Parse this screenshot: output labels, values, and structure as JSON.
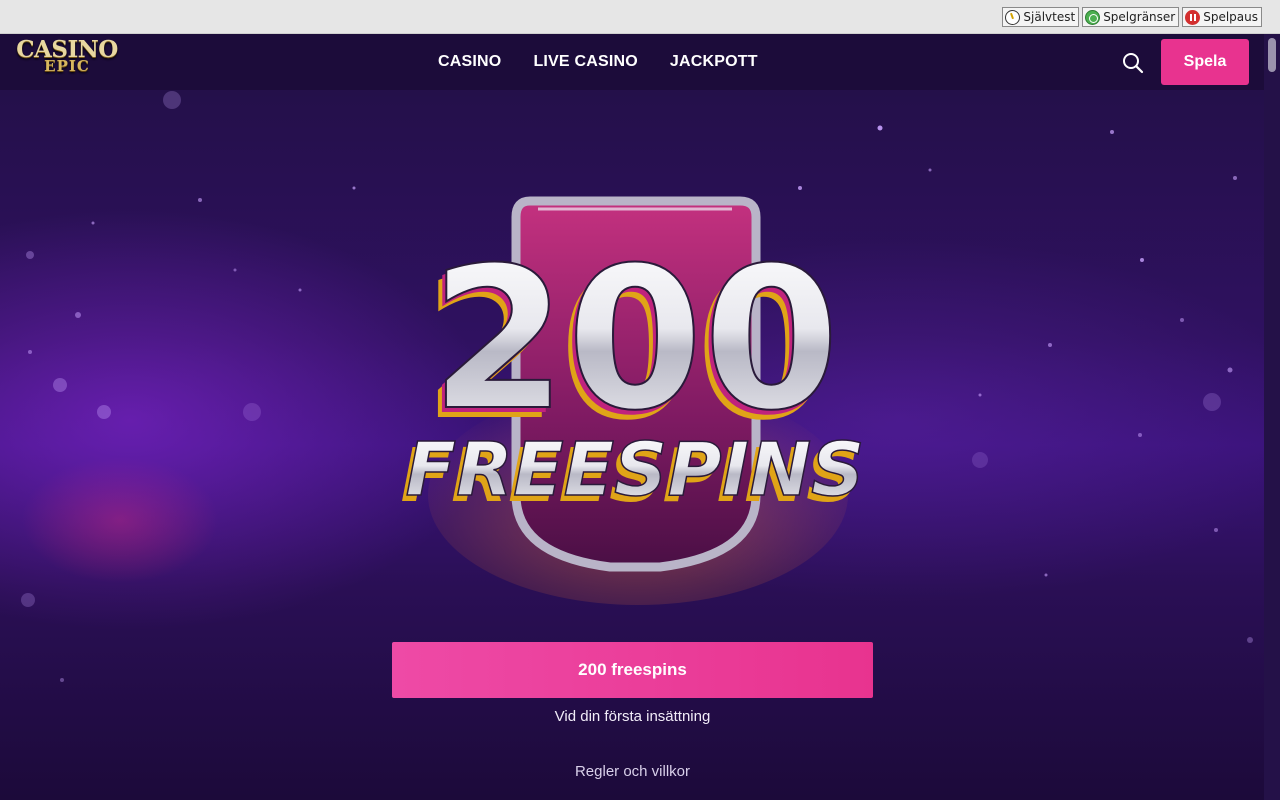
{
  "responsible_gaming": {
    "buttons": [
      {
        "label": "Självtest",
        "icon": "self-test-icon"
      },
      {
        "label": "Spelgränser",
        "icon": "limits-icon"
      },
      {
        "label": "Spelpaus",
        "icon": "pause-icon"
      }
    ]
  },
  "header": {
    "logo": {
      "top": "CASINO",
      "bottom": "EPIC"
    },
    "nav": [
      {
        "label": "CASINO"
      },
      {
        "label": "LIVE CASINO"
      },
      {
        "label": "JACKPOTT"
      }
    ],
    "search_icon": "search-icon",
    "play_label": "Spela"
  },
  "hero": {
    "badge": {
      "number": "200",
      "word": "FREESPINS"
    },
    "cta_label": "200 freespins",
    "cta_subtext": "Vid din första insättning",
    "terms_label": "Regler och villkor"
  },
  "colors": {
    "accent_pink": "#e8338f",
    "header_bg": "#1c0c3a",
    "hero_purple": "#3a137a"
  }
}
